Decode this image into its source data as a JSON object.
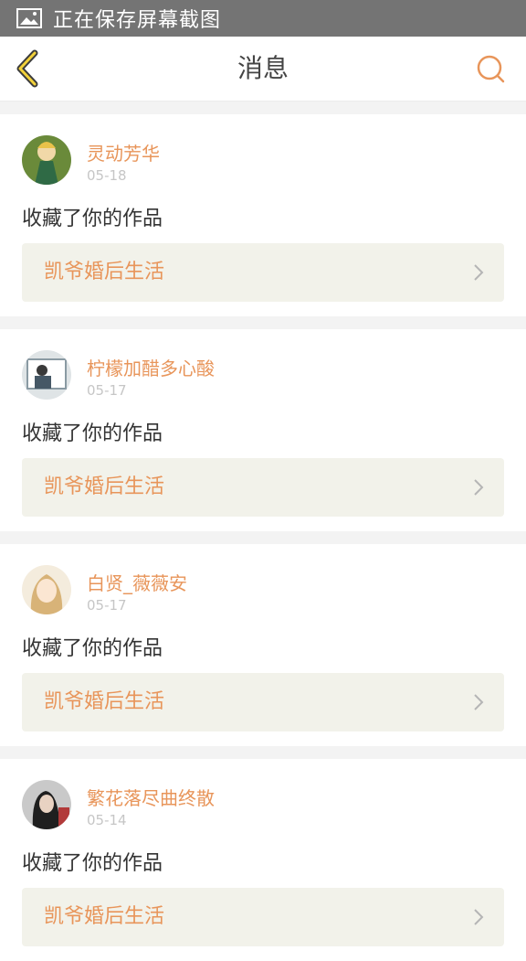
{
  "status_bar": {
    "text": "正在保存屏幕截图",
    "icon": "image-icon"
  },
  "header": {
    "title": "消息",
    "back_icon": "back-chevron-icon",
    "search_icon": "search-icon",
    "accent": "#e8955a"
  },
  "messages": [
    {
      "user": "灵动芳华",
      "date": "05-18",
      "action": "收藏了你的作品",
      "work": "凯爷婚后生活"
    },
    {
      "user": "柠檬加醋多心酸",
      "date": "05-17",
      "action": "收藏了你的作品",
      "work": "凯爷婚后生活"
    },
    {
      "user": "白贤_薇薇安",
      "date": "05-17",
      "action": "收藏了你的作品",
      "work": "凯爷婚后生活"
    },
    {
      "user": "繁花落尽曲终散",
      "date": "05-14",
      "action": "收藏了你的作品",
      "work": "凯爷婚后生活"
    }
  ]
}
